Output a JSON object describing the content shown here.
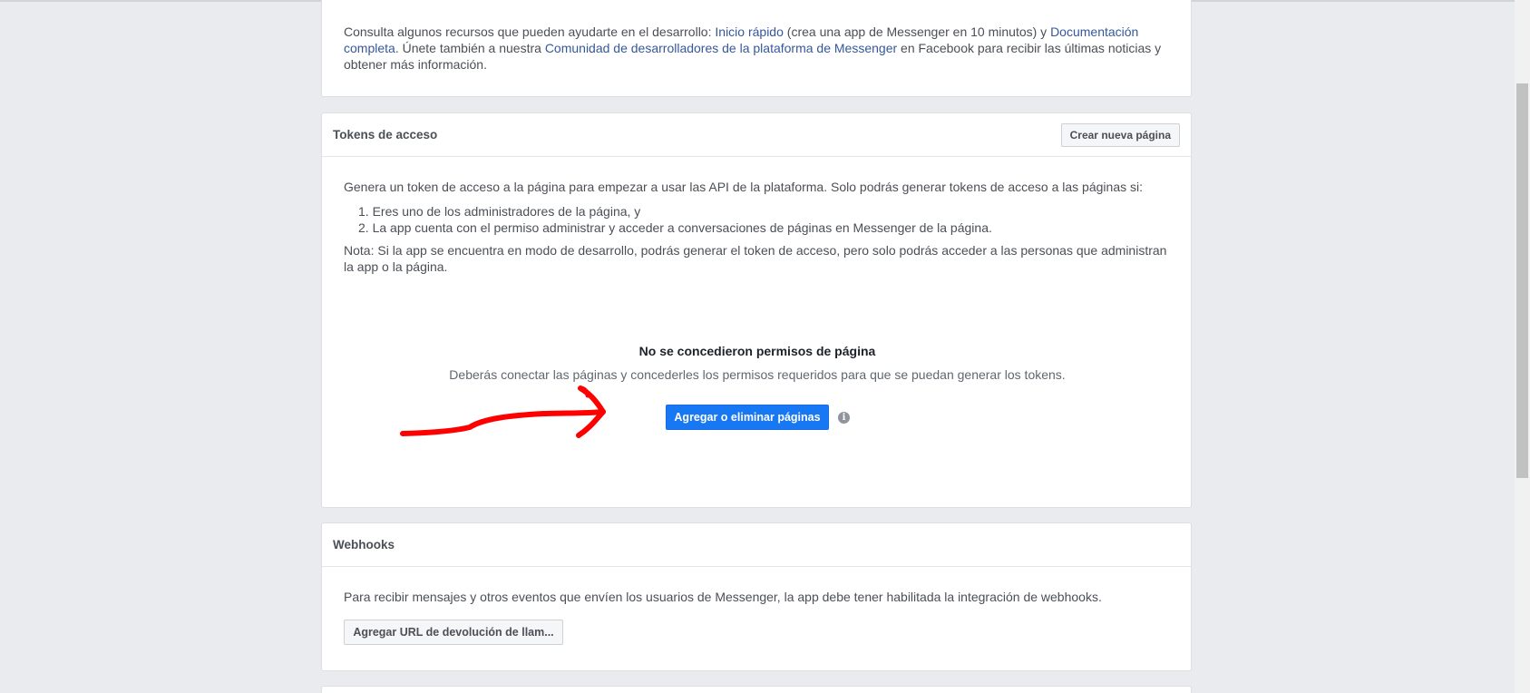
{
  "resources": {
    "prefix": "Consulta algunos recursos que pueden ayudarte en el desarrollo: ",
    "link_quickstart": "Inicio rápido",
    "mid1": " (crea una app de Messenger en 10 minutos) y ",
    "link_docs": "Documentación completa",
    "mid2": ". Únete también a nuestra ",
    "link_community": "Comunidad de desarrolladores de la plataforma de Messenger",
    "suffix": " en Facebook para recibir las últimas noticias y obtener más información."
  },
  "tokens": {
    "title": "Tokens de acceso",
    "create_page_button": "Crear nueva página",
    "intro": "Genera un token de acceso a la página para empezar a usar las API de la plataforma. Solo podrás generar tokens de acceso a las páginas si:",
    "conditions": [
      "1. Eres uno de los administradores de la página, y",
      "2. La app cuenta con el permiso administrar y acceder a conversaciones de páginas en Messenger de la página."
    ],
    "note": "Nota: Si la app se encuentra en modo de desarrollo, podrás generar el token de acceso, pero solo podrás acceder a las personas que administran la app o la página.",
    "empty_title": "No se concedieron permisos de página",
    "empty_description": "Deberás conectar las páginas y concederles los permisos requeridos para que se puedan generar los tokens.",
    "add_remove_button": "Agregar o eliminar páginas",
    "info_icon": "info-icon"
  },
  "annotation": {
    "icon": "red-arrow-annotation",
    "color": "#ff0000"
  },
  "webhooks": {
    "title": "Webhooks",
    "description": "Para recibir mensajes y otros eventos que envíen los usuarios de Messenger, la app debe tener habilitada la integración de webhooks.",
    "add_callback_button": "Agregar URL de devolución de llam..."
  },
  "colors": {
    "background": "#e9ebee",
    "link": "#365899",
    "primary_button": "#1877f2"
  }
}
